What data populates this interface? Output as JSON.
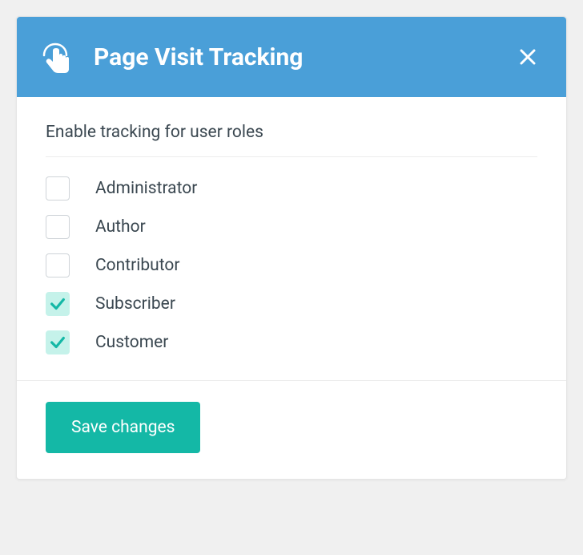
{
  "header": {
    "title": "Page Visit Tracking"
  },
  "body": {
    "section_title": "Enable tracking for user roles",
    "roles": [
      {
        "label": "Administrator",
        "checked": false
      },
      {
        "label": "Author",
        "checked": false
      },
      {
        "label": "Contributor",
        "checked": false
      },
      {
        "label": "Subscriber",
        "checked": true
      },
      {
        "label": "Customer",
        "checked": true
      }
    ]
  },
  "footer": {
    "save_label": "Save changes"
  }
}
